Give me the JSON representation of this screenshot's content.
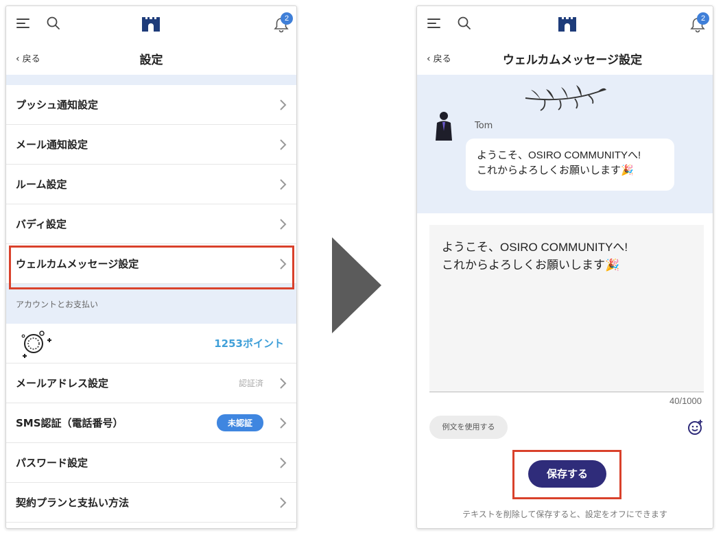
{
  "left_screen": {
    "title": "設定",
    "back_label": "戻る",
    "bell_badge": "2",
    "rows": [
      {
        "label": "プッシュ通知設定"
      },
      {
        "label": "メール通知設定"
      },
      {
        "label": "ルーム設定"
      },
      {
        "label": "バディ設定"
      },
      {
        "label": "ウェルカムメッセージ設定"
      }
    ],
    "section_header": "アカウントとお支払い",
    "points_label": "1253ポイント",
    "account_rows": [
      {
        "label": "メールアドレス設定",
        "status": "認証済"
      },
      {
        "label": "SMS認証（電話番号）",
        "badge": "未認証"
      },
      {
        "label": "パスワード設定"
      },
      {
        "label": "契約プランと支払い方法"
      }
    ]
  },
  "right_screen": {
    "title": "ウェルカムメッセージ設定",
    "back_label": "戻る",
    "bell_badge": "2",
    "sender_name": "Tom",
    "bubble_line1": "ようこそ、OSIRO COMMUNITYへ!",
    "bubble_line2": "これからよろしくお願いします🎉",
    "textarea_line1": "ようこそ、OSIRO COMMUNITYへ!",
    "textarea_line2": "これからよろしくお願いします🎉",
    "char_count": "40/1000",
    "sample_button": "例文を使用する",
    "save_button": "保存する",
    "footer_note": "テキストを削除して保存すると、設定をオフにできます"
  },
  "colors": {
    "highlight": "#d9412b",
    "accent_blue": "#3f86e0",
    "save_button": "#2f2c7a",
    "section_bg": "#e7eef9"
  },
  "icons": [
    "menu-icon",
    "search-icon",
    "castle-logo-icon",
    "bell-icon",
    "chevron-right-icon",
    "smile-plus-icon"
  ]
}
